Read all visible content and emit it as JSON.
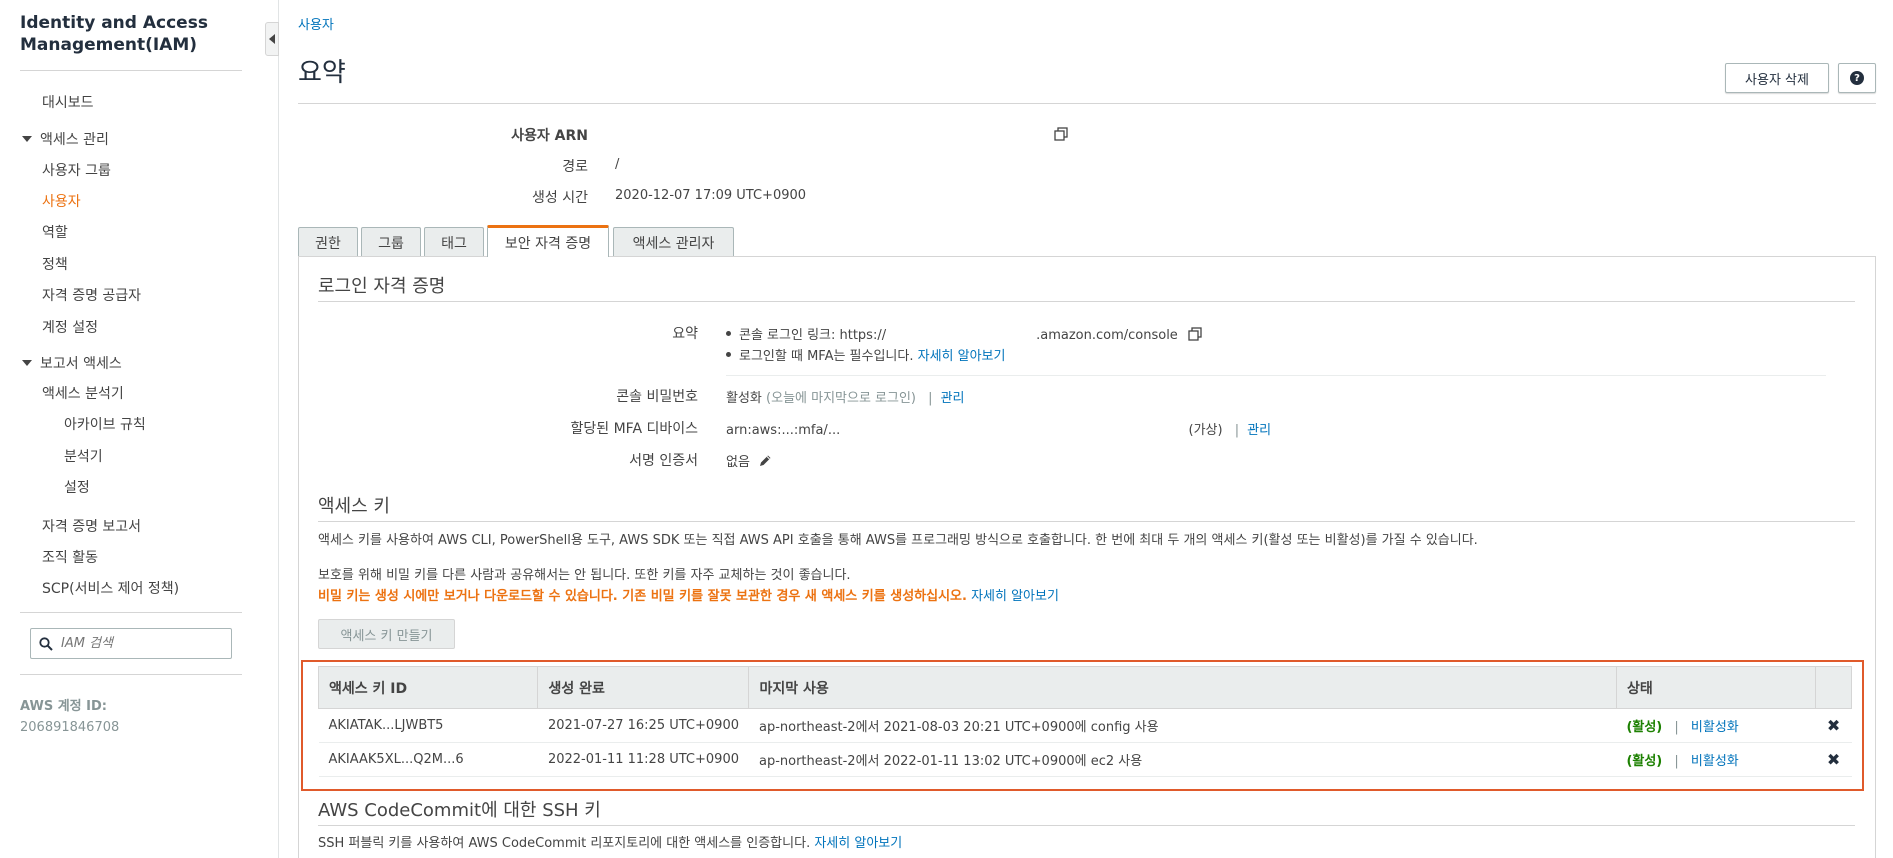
{
  "sidebar": {
    "title_line1": "Identity and Access",
    "title_line2": "Management(IAM)",
    "dashboard": "대시보드",
    "access_mgmt_group": "액세스 관리",
    "items": [
      "사용자 그룹",
      "사용자",
      "역할",
      "정책",
      "자격 증명 공급자",
      "계정 설정"
    ],
    "report_group": "보고서 액세스",
    "analyzer": "액세스 분석기",
    "analyzer_sub": [
      "아카이브 규칙",
      "분석기",
      "설정"
    ],
    "report_items": [
      "자격 증명 보고서",
      "조직 활동",
      "SCP(서비스 제어 정책)"
    ],
    "search_placeholder": "IAM 검색",
    "account_label": "AWS 계정 ID:",
    "account_id": "206891846708"
  },
  "breadcrumb": "사용자",
  "page_title": "요약",
  "buttons": {
    "delete_user": "사용자 삭제",
    "help": "?"
  },
  "summary": {
    "arn_label": "사용자 ARN",
    "arn_value": "",
    "path_label": "경로",
    "path_value": "/",
    "created_label": "생성 시간",
    "created_value": "2020-12-07 17:09 UTC+0900"
  },
  "tabs": [
    "권한",
    "그룹",
    "태그",
    "보안 자격 증명",
    "액세스 관리자"
  ],
  "login": {
    "title": "로그인 자격 증명",
    "summary_label": "요약",
    "console_link_text": "콘솔 로그인 링크: https://",
    "console_link_tail": ".amazon.com/console",
    "mfa_text": "로그인할 때 MFA는 필수입니다.",
    "learn_more": "자세히 알아보기",
    "password_label": "콘솔 비밀번호",
    "password_value": "활성화",
    "password_note": "(오늘에 마지막으로 로그인)",
    "manage": "관리",
    "mfa_label": "할당된 MFA 디바이스",
    "mfa_value": "arn:aws:...:mfa/...",
    "mfa_virtual": "(가상)",
    "cert_label": "서명 인증서",
    "cert_value": "없음"
  },
  "access_keys": {
    "title": "액세스 키",
    "desc": "액세스 키를 사용하여 AWS CLI, PowerShell용 도구, AWS SDK 또는 직접 AWS API 호출을 통해 AWS를 프로그래밍 방식으로 호출합니다. 한 번에 최대 두 개의 액세스 키(활성 또는 비활성)를 가질 수 있습니다.",
    "protect": "보호를 위해 비밀 키를 다른 사람과 공유해서는 안 됩니다. 또한 키를 자주 교체하는 것이 좋습니다.",
    "warning": "비밀 키는 생성 시에만 보거나 다운로드할 수 있습니다. 기존 비밀 키를 잘못 보관한 경우 새 액세스 키를 생성하십시오.",
    "learn_more": "자세히 알아보기",
    "create_button": "액세스 키 만들기",
    "columns": [
      "액세스 키 ID",
      "생성 완료",
      "마지막 사용",
      "상태"
    ],
    "rows": [
      {
        "id": "AKIATAK...LJWBT5",
        "created": "2021-07-27 16:25 UTC+0900",
        "last_used": "ap-northeast-2에서 2021-08-03 20:21 UTC+0900에 config 사용",
        "status": "(활성)",
        "action": "비활성화"
      },
      {
        "id": "AKIAAK5XL...Q2M...6",
        "created": "2022-01-11 11:28 UTC+0900",
        "last_used": "ap-northeast-2에서 2022-01-11 13:02 UTC+0900에 ec2 사용",
        "status": "(활성)",
        "action": "비활성화"
      }
    ]
  },
  "ssh": {
    "title_en": "AWS CodeCommit",
    "title_ko": "에 대한 SSH 키",
    "desc": "SSH 퍼블릭 키를 사용하여 AWS CodeCommit 리포지토리에 대한 액세스를 인증합니다.",
    "learn_more": "자세히 알아보기"
  },
  "colors": {
    "accent": "#ec7211",
    "link": "#0073bb",
    "active": "#1d8102",
    "highlight": "#e05a2b"
  }
}
